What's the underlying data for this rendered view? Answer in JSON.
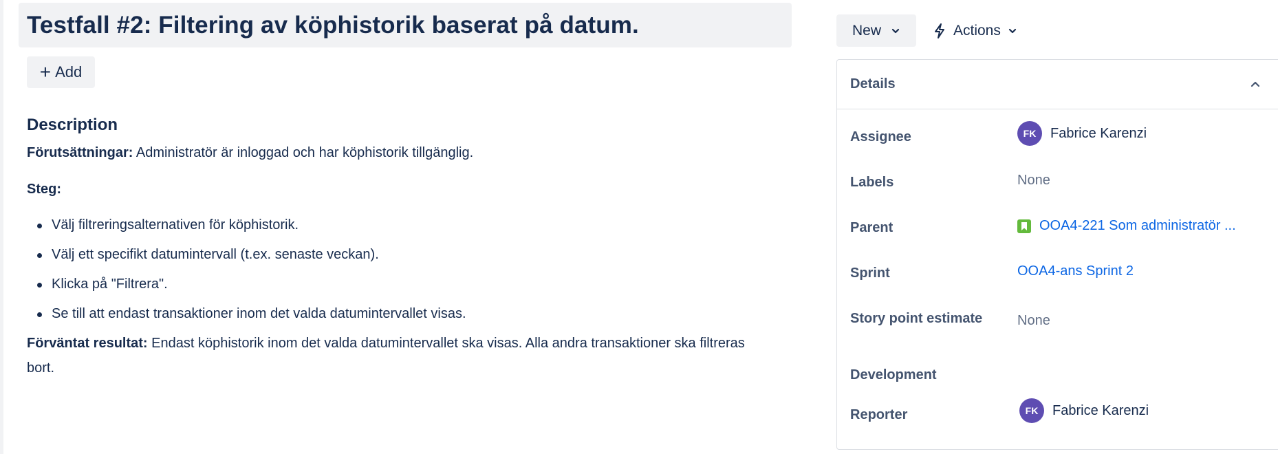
{
  "issue": {
    "title": "Testfall #2: Filtering av köphistorik baserat på datum.",
    "add_label": "Add"
  },
  "description": {
    "heading": "Description",
    "preconditions_label": "Förutsättningar:",
    "preconditions_text": " Administratör  är inloggad och har köphistorik tillgänglig.",
    "steps_label": "Steg:",
    "steps": [
      "Välj filtreringsalternativen för köphistorik.",
      "Välj ett specifikt datumintervall (t.ex. senaste veckan).",
      "Klicka på \"Filtrera\".",
      "Se till att endast transaktioner inom det valda datumintervallet visas."
    ],
    "expected_label": "Förväntat resultat:",
    "expected_text_line1": " Endast köphistorik inom det valda datumintervallet ska visas. Alla andra transaktioner ska filtreras",
    "expected_text_line2": "bort."
  },
  "toolbar": {
    "status_label": "New",
    "actions_label": "Actions"
  },
  "details": {
    "title": "Details",
    "assignee": {
      "label": "Assignee",
      "initials": "FK",
      "name": "Fabrice Karenzi"
    },
    "labels": {
      "label": "Labels",
      "value": "None"
    },
    "parent": {
      "label": "Parent",
      "value": "OOA4-221 Som administratör ..."
    },
    "sprint": {
      "label": "Sprint",
      "value": "OOA4-ans Sprint 2"
    },
    "story_points": {
      "label": "Story point estimate",
      "value": "None"
    },
    "development": {
      "label": "Development"
    },
    "reporter": {
      "label": "Reporter",
      "initials": "FK",
      "name": "Fabrice Karenzi"
    }
  },
  "colors": {
    "text": "#172b4d",
    "subtle_text": "#44546f",
    "muted_text": "#626f86",
    "link": "#0c66e4",
    "avatar_bg": "#5e4db2",
    "parent_icon_bg": "#63ba3c",
    "button_bg": "#f1f2f4"
  },
  "icons": {
    "add": "plus-icon",
    "status_chevron": "chevron-down-icon",
    "actions": "lightning-icon",
    "actions_chevron": "chevron-down-icon",
    "collapse": "chevron-up-icon",
    "parent": "story-bookmark-icon"
  }
}
